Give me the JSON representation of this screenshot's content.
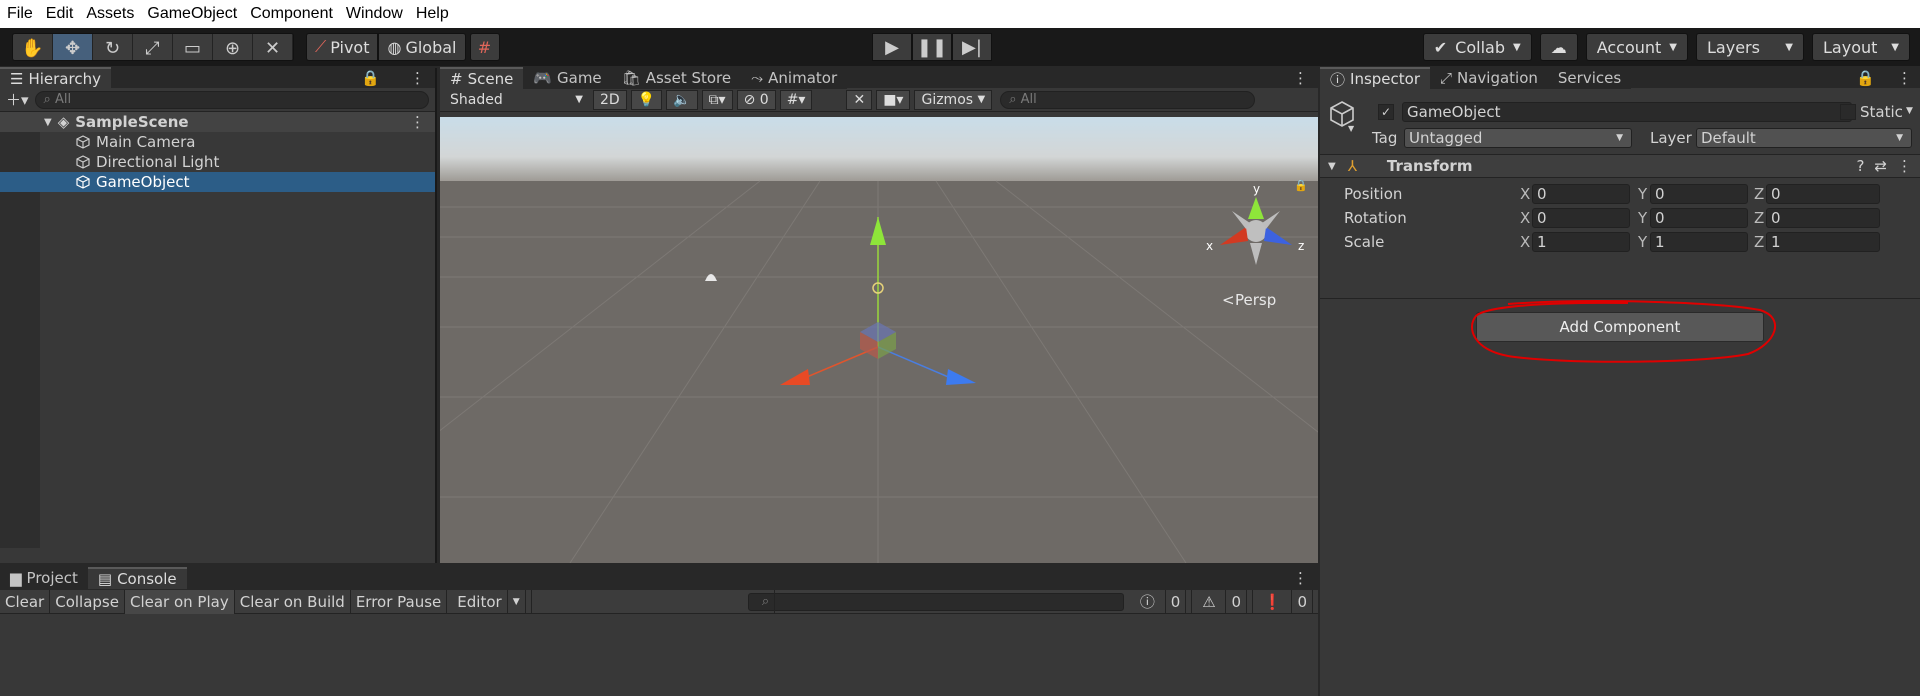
{
  "menu": [
    "File",
    "Edit",
    "Assets",
    "GameObject",
    "Component",
    "Window",
    "Help"
  ],
  "toolbar": {
    "pivot": "Pivot",
    "global": "Global",
    "collab": "Collab",
    "account": "Account",
    "layers": "Layers",
    "layout": "Layout"
  },
  "hierarchy": {
    "tab": "Hierarchy",
    "search_placeholder": "All",
    "scene": "SampleScene",
    "items": [
      "Main Camera",
      "Directional Light",
      "GameObject"
    ]
  },
  "scene": {
    "tabs": [
      "Scene",
      "Game",
      "Asset Store",
      "Animator"
    ],
    "shading": "Shaded",
    "mode2d": "2D",
    "hidden_count": "0",
    "gizmos": "Gizmos",
    "search_placeholder": "All",
    "persp": "Persp",
    "axis_x": "x",
    "axis_y": "y",
    "axis_z": "z"
  },
  "inspector": {
    "tabs": [
      "Inspector",
      "Navigation",
      "Services"
    ],
    "name": "GameObject",
    "static": "Static",
    "tag_label": "Tag",
    "tag_value": "Untagged",
    "layer_label": "Layer",
    "layer_value": "Default",
    "component": "Transform",
    "rows": [
      {
        "label": "Position",
        "x": "0",
        "y": "0",
        "z": "0"
      },
      {
        "label": "Rotation",
        "x": "0",
        "y": "0",
        "z": "0"
      },
      {
        "label": "Scale",
        "x": "1",
        "y": "1",
        "z": "1"
      }
    ],
    "axes": [
      "X",
      "Y",
      "Z"
    ],
    "add_component": "Add Component"
  },
  "console": {
    "tabs": [
      "Project",
      "Console"
    ],
    "buttons": [
      "Clear",
      "Collapse",
      "Clear on Play",
      "Clear on Build",
      "Error Pause",
      "Editor"
    ],
    "counts": [
      "0",
      "0",
      "0"
    ]
  },
  "colors": {
    "selection": "#2c5d87",
    "annotation": "#e00000"
  }
}
